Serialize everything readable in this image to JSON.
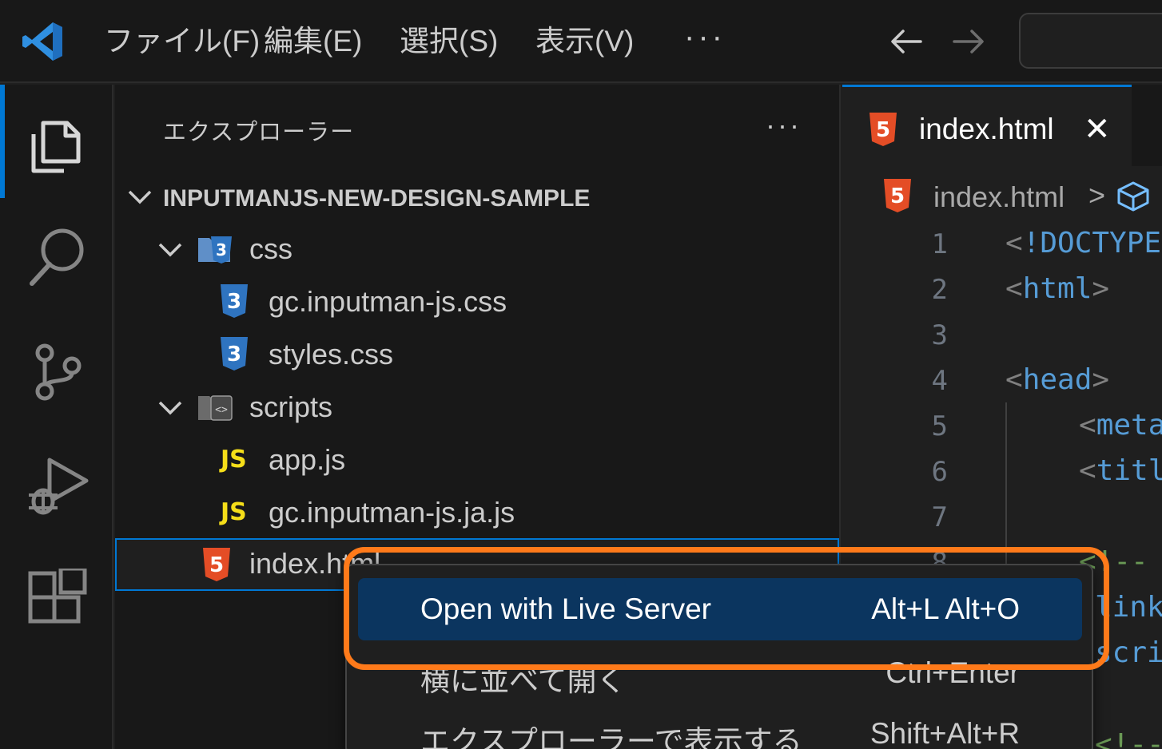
{
  "menubar": {
    "items": [
      {
        "label": "ファイル(F)"
      },
      {
        "label": "編集(E)"
      },
      {
        "label": "選択(S)"
      },
      {
        "label": "表示(V)"
      }
    ],
    "more": "···"
  },
  "icons": {
    "app_logo": "vscode-logo",
    "back": "arrow-left-icon",
    "forward": "arrow-right-icon",
    "explorer": "files-icon",
    "search": "search-icon",
    "scm": "source-control-icon",
    "debug": "run-debug-icon",
    "extensions": "extensions-icon"
  },
  "colors": {
    "accent": "#0078d4",
    "highlight_box": "#ff7a1a",
    "menu_active": "#0b355f",
    "html_icon": "#e44d26",
    "css_icon": "#2f74c0",
    "js_icon": "#f5de19"
  },
  "explorer": {
    "title": "エクスプローラー",
    "more": "···",
    "root": "INPUTMANJS-NEW-DESIGN-SAMPLE",
    "items": [
      {
        "label": "css",
        "type": "folder"
      },
      {
        "label": "gc.inputman-js.css",
        "type": "css"
      },
      {
        "label": "styles.css",
        "type": "css"
      },
      {
        "label": "scripts",
        "type": "folder"
      },
      {
        "label": "app.js",
        "type": "js"
      },
      {
        "label": "gc.inputman-js.ja.js",
        "type": "js"
      },
      {
        "label": "index.html",
        "type": "html"
      }
    ],
    "js_badge": "JS"
  },
  "editor": {
    "tab_label": "index.html",
    "tab_close": "✕",
    "breadcrumb_file": "index.html",
    "breadcrumb_sep": ">",
    "line_numbers": [
      "1",
      "2",
      "3",
      "4",
      "5",
      "6",
      "7",
      "8"
    ],
    "code": {
      "l1_open": "<",
      "l1_tag": "!DOCTYPE",
      "l2_open": "<",
      "l2_tag": "html",
      "l2_close": ">",
      "l4_open": "<",
      "l4_tag": "head",
      "l4_close": ">",
      "l5_open": "<",
      "l5_tag": "meta",
      "l6_open": "<",
      "l6_tag": "titl",
      "l8_comment": "<!--",
      "l9_tag": "link",
      "l10_tag": "scri",
      "l12_comment": "<!--"
    }
  },
  "context_menu": {
    "items": [
      {
        "label": "Open with Live Server",
        "shortcut": "Alt+L Alt+O"
      },
      {
        "label": "横に並べて開く",
        "shortcut": "Ctrl+Enter"
      },
      {
        "label": "エクスプローラーで表示する",
        "shortcut": "Shift+Alt+R"
      }
    ]
  }
}
